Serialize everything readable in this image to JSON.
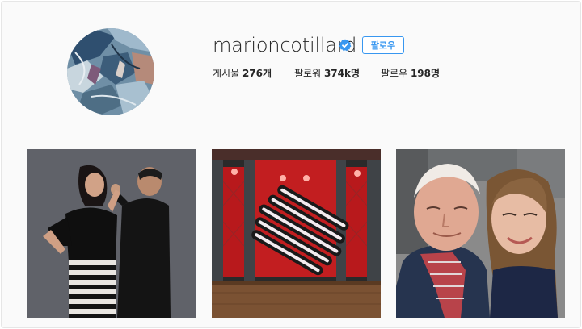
{
  "profile": {
    "username": "marioncotillard",
    "follow_label": "팔로우",
    "stats": {
      "posts_label": "게시물",
      "posts_value": "276개",
      "followers_label": "팔로워",
      "followers_value": "374k명",
      "following_label": "팔로우",
      "following_value": "198명"
    }
  },
  "colors": {
    "accent": "#3897f0",
    "verified_badge": "#3897f0",
    "text": "#262626",
    "background": "#fafafa"
  },
  "icons": {
    "verified": "verified-badge-icon"
  },
  "posts": [
    {
      "subject": "photo-couple-studio"
    },
    {
      "subject": "photo-stage-lights"
    },
    {
      "subject": "photo-selfie-elderly-man"
    }
  ]
}
